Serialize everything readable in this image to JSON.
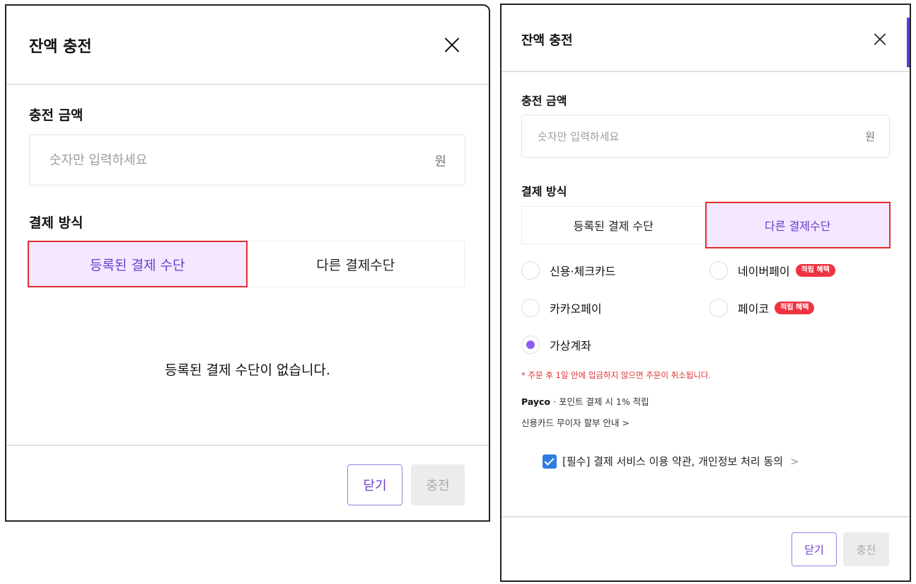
{
  "left_modal": {
    "title": "잔액 충전",
    "amount_label": "충전 금액",
    "amount_placeholder": "숫자만 입력하세요",
    "amount_unit": "원",
    "method_label": "결제 방식",
    "tabs": [
      {
        "label": "등록된 결제 수단",
        "active": true
      },
      {
        "label": "다른 결제수단",
        "active": false
      }
    ],
    "empty_message": "등록된 결제 수단이 없습니다.",
    "close_label": "닫기",
    "charge_label": "충전"
  },
  "right_modal": {
    "title": "잔액 충전",
    "amount_label": "충전 금액",
    "amount_placeholder": "숫자만 입력하세요",
    "amount_unit": "원",
    "method_label": "결제 방식",
    "tabs": [
      {
        "label": "등록된 결제 수단",
        "active": false
      },
      {
        "label": "다른 결제수단",
        "active": true
      }
    ],
    "options": [
      {
        "label": "신용·체크카드",
        "selected": false
      },
      {
        "label": "네이버페이",
        "selected": false,
        "badge": "적립 혜택"
      },
      {
        "label": "카카오페이",
        "selected": false
      },
      {
        "label": "페이코",
        "selected": false,
        "badge": "적립 혜택"
      },
      {
        "label": "가상계좌",
        "selected": true
      }
    ],
    "notice": "* 주문 후 1일 안에 입금하지 않으면 주문이 취소됩니다.",
    "payco_brand": "Payco",
    "payco_text": " · 포인트 결제 시 1% 적립",
    "installment_link": "신용카드 무이자 할부 안내 >",
    "agreement": "[필수] 결제 서비스 이용 약관, 개인정보 처리 동의",
    "agreement_chevron": ">",
    "close_label": "닫기",
    "charge_label": "충전"
  },
  "colors": {
    "accent": "#6b3bd0",
    "active_tab_bg": "#f3e8ff",
    "highlight_border": "#e0302f",
    "badge": "#ef3340",
    "checkbox": "#2f7de1"
  }
}
